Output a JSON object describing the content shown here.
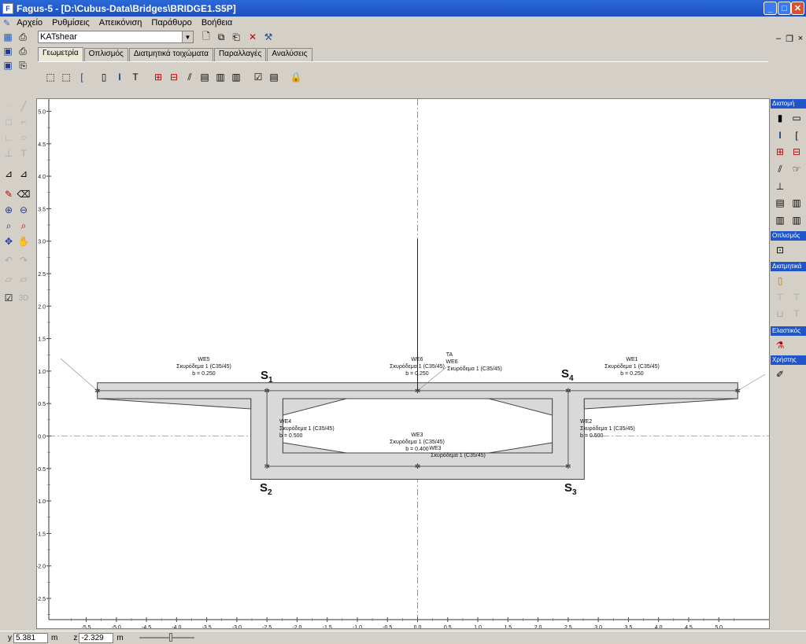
{
  "window": {
    "title": "Fagus-5 - [D:\\Cubus-Data\\Bridges\\BRIDGE1.S5P]"
  },
  "menu": [
    "Αρχείο",
    "Ρυθμίσεις",
    "Απεικόνιση",
    "Παράθυρο",
    "Βοήθεια"
  ],
  "toolbar": {
    "combo_value": "KATshear"
  },
  "tabs": [
    "Γεωμετρία",
    "Οπλισμός",
    "Διατμητικά τοιχώματα",
    "Παραλλαγές",
    "Αναλύσεις"
  ],
  "right_panels": {
    "diatomi": "Διατομή",
    "oplismos": "Οπλισμός",
    "diatmitika": "Διατμητικά",
    "elastikos": "Ελαστικός",
    "xristis": "Χρήστης"
  },
  "drawing": {
    "y_ticks": [
      "5.0",
      "4.5",
      "4.0",
      "3.5",
      "3.0",
      "2.5",
      "2.0",
      "1.5",
      "1.0",
      "0.5",
      "0.0",
      "-0.5",
      "-1.0",
      "-1.5",
      "-2.0",
      "-2.5"
    ],
    "x_ticks": [
      "-5.5",
      "-5.0",
      "-4.5",
      "-4.0",
      "-3.5",
      "-3.0",
      "-2.5",
      "-2.0",
      "-1.5",
      "-1.0",
      "-0.5",
      "0.0",
      "0.5",
      "1.0",
      "1.5",
      "2.0",
      "2.5",
      "3.0",
      "3.5",
      "4.0",
      "4.5",
      "5.0"
    ],
    "labels": {
      "we5_name": "WE5",
      "we5_mat": "Σκυρόδεμα 1 (C35/45)",
      "we5_b": "b = 0.250",
      "we6_name": "WE6",
      "we6_mat": "Σκυρόδεμα 1 (C35/45)",
      "we6_b": "b = 0.250",
      "ta_name": "TA",
      "we6b_name": "WE6",
      "we6b_mat": "Σκυρόδεμα 1 (C35/45)",
      "we1_name": "WE1",
      "we1_mat": "Σκυρόδεμα 1 (C35/45)",
      "we1_b": "b = 0.250",
      "we4_name": "WE4",
      "we4_mat": "Σκυρόδεμα 1 (C35/45)",
      "we4_b": "b = 0.500",
      "we2_name": "WE2",
      "we2_mat": "Σκυρόδεμα 1 (C35/45)",
      "we2_b": "b = 0.500",
      "we3_name": "WE3",
      "we3_mat": "Σκυρόδεμα 1 (C35/45)",
      "we3_b": "b = 0.400",
      "we3b_name": "WE3",
      "we3b_mat": "Σκυρόδεμα 1 (C35/45)",
      "s1": "S",
      "s1_sub": "1",
      "s2": "S",
      "s2_sub": "2",
      "s3": "S",
      "s3_sub": "3",
      "s4": "S",
      "s4_sub": "4"
    }
  },
  "status": {
    "y_label": "y",
    "y_value": "5.381",
    "y_unit": "m",
    "z_label": "z",
    "z_value": "-2.329",
    "z_unit": "m"
  },
  "colors": {
    "titlebar": "#1c50c0",
    "section_fill": "#d9d9d9",
    "panel_header": "#1f55c8"
  }
}
